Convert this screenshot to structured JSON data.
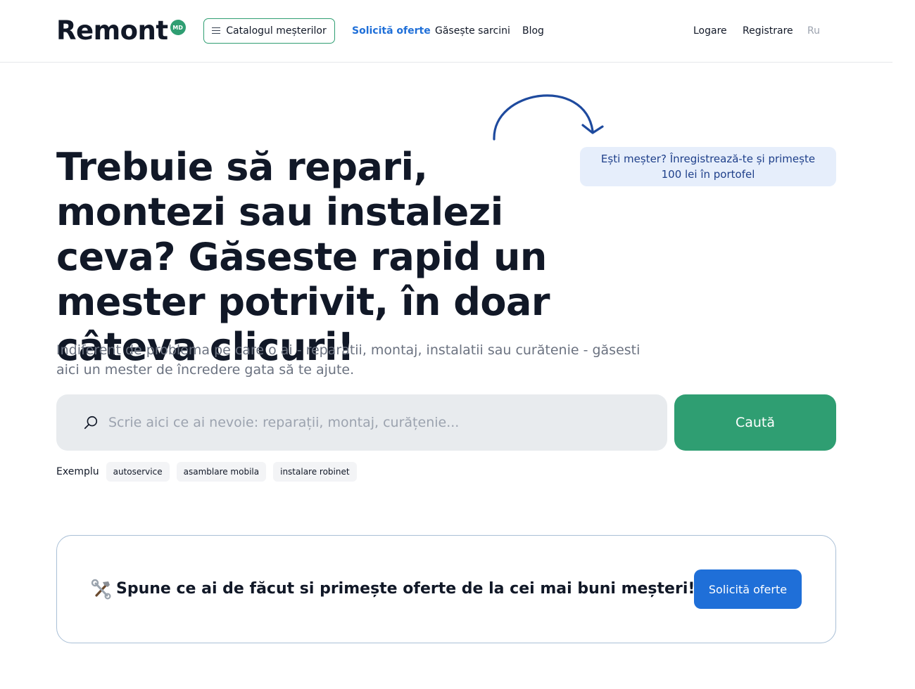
{
  "header": {
    "logo_text": "Remont",
    "logo_badge": "MD",
    "catalog_label": "Catalogul meșterilor",
    "nav": {
      "request_offers": "Solicită oferte",
      "find_tasks": "Găsește sarcini",
      "blog": "Blog",
      "login": "Logare",
      "register": "Registrare",
      "lang": "Ru"
    }
  },
  "promo": {
    "bubble_text": "Ești meșter? Înregistrează-te și primește 100 lei în portofel"
  },
  "hero": {
    "title": "Trebuie să repari, montezi sau instalezi ceva? Găseste rapid un mester potrivit, în doar câteva clicuri!",
    "subtitle": "Indiferent de problema pe care o ai - reparatii, montaj, instalatii sau curătenie - găsesti aici un mester de încredere gata să te ajute."
  },
  "search": {
    "placeholder": "Scrie aici ce ai nevoie: reparații, montaj, curățenie...",
    "value": "",
    "button_label": "Caută"
  },
  "examples": {
    "label": "Exemplu",
    "chips": [
      "autoservice",
      "asamblare mobila",
      "instalare robinet"
    ]
  },
  "cta": {
    "text": "Spune ce ai de făcut si primește oferte de la cei mai buni meșteri!",
    "button_label": "Solicită oferte"
  },
  "colors": {
    "brand_green": "#2f9e72",
    "accent_blue": "#1f6fd8",
    "bubble_bg": "#e6eefb",
    "arrow_blue": "#1e4a9e"
  },
  "icons": {
    "menu": "hamburger-icon",
    "search": "search-icon",
    "tools": "hammer-wrench-icon",
    "arrow": "curved-arrow-icon"
  }
}
